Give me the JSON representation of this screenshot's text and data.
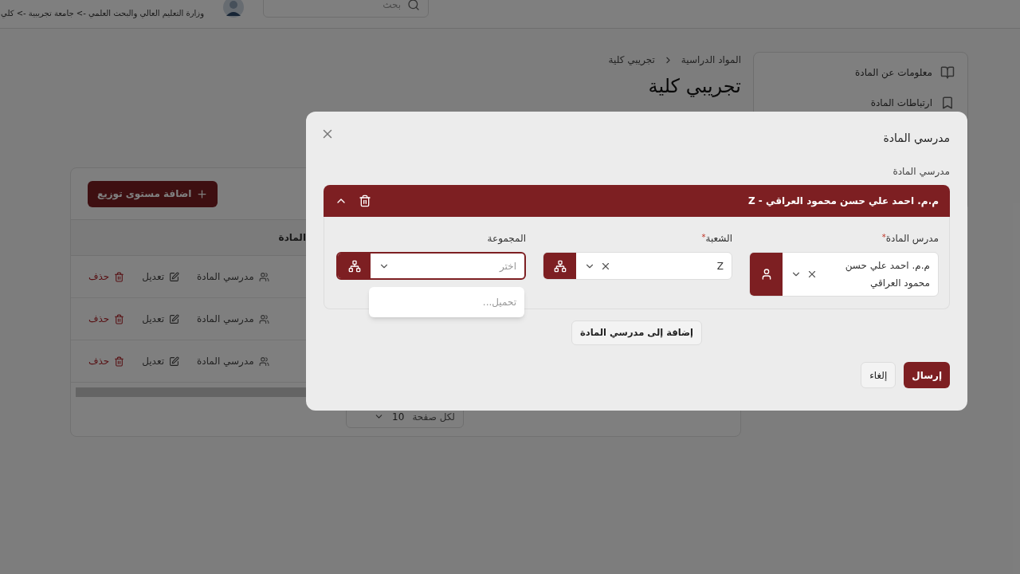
{
  "header": {
    "search": {
      "placeholder": "بحث"
    },
    "path": "وزارة التعليم العالي والبحث العلمي -> جامعة تجريبية -> كلي"
  },
  "sidebar": {
    "items": [
      {
        "label": "معلومات عن المادة",
        "kind": "book"
      },
      {
        "label": "ارتباطات المادة",
        "kind": "link"
      }
    ]
  },
  "breadcrumb": [
    "المواد الدراسية",
    "تجريبي كلية"
  ],
  "title": "تجريبي كلية",
  "table": {
    "add_button": "اضافة مستوى توزيع",
    "column_1": "المادة",
    "rows": [
      {
        "teachers": "مدرسي المادة",
        "edit": "تعديل",
        "delete": "حذف"
      },
      {
        "teachers": "مدرسي المادة",
        "edit": "تعديل",
        "delete": "حذف"
      },
      {
        "teachers": "مدرسي المادة",
        "edit": "تعديل",
        "delete": "حذف"
      }
    ],
    "pagination": {
      "per_page": "لكل صفحة",
      "value": "10"
    }
  },
  "dialog": {
    "title": "مدرسي المادة",
    "section_label": "مدرسي المادة",
    "entries": [
      {
        "title": "م.م. احمد علي حسن محمود العراقي - Z",
        "expanded": true,
        "fields": [
          {
            "kind": "person",
            "label": "مدرس المادة",
            "required_mark": "*",
            "value": "م.م. احمد علي حسن محمود العراقي",
            "focused": false
          },
          {
            "kind": "tree",
            "label": "الشعبة",
            "required_mark": "*",
            "value": "Z",
            "focused": false
          },
          {
            "kind": "tree",
            "label": "المجموعة",
            "placeholder": "اختر",
            "focused": true,
            "dropdown": "تحميل..."
          }
        ]
      }
    ],
    "add_button": "إضافة إلى مدرسي المادة",
    "submit": "إرسال",
    "cancel": "إلغاء"
  }
}
